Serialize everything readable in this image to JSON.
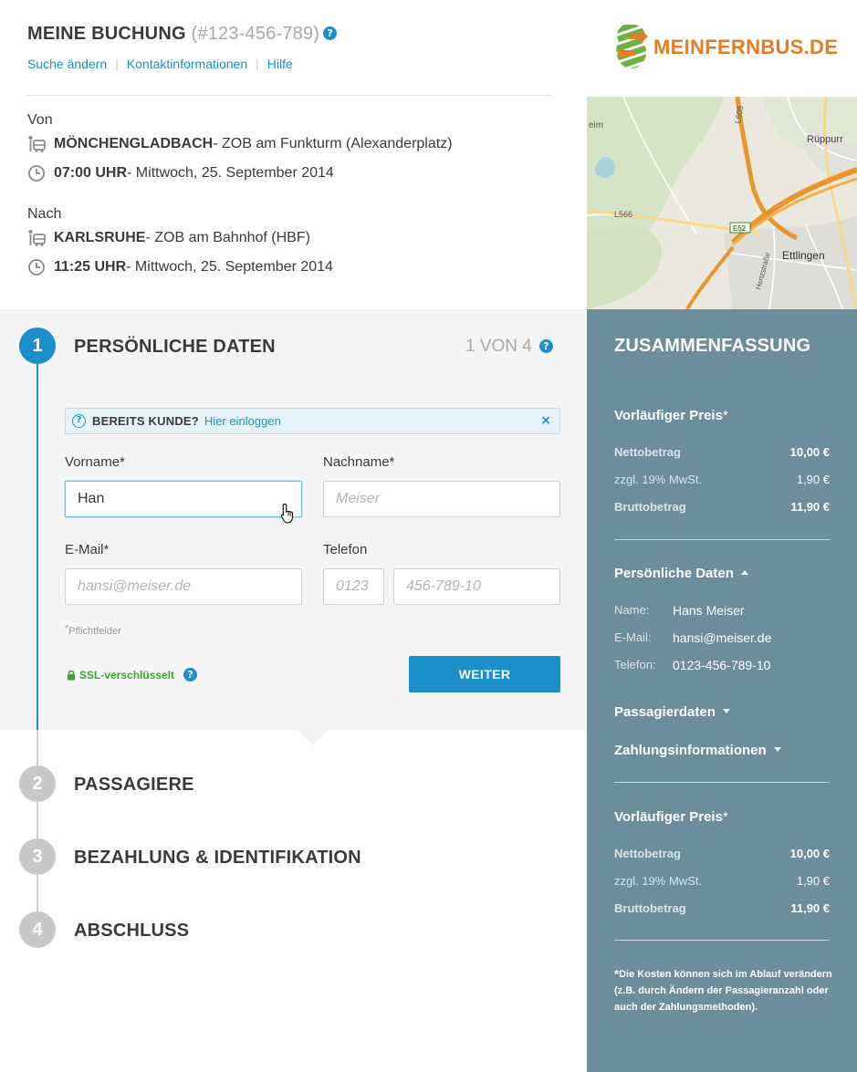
{
  "booking": {
    "title": "MEINE BUCHUNG",
    "number": "(#123-456-789)",
    "help": "?"
  },
  "top_links": {
    "change_search": "Suche ändern",
    "contact": "Kontaktinformationen",
    "help": "Hilfe",
    "separator": "|"
  },
  "route": {
    "from": {
      "label": "Von",
      "city": "MÖNCHENGLADBACH",
      "station": " - ZOB am Funkturm (Alexanderplatz)",
      "time": "07:00 UHR",
      "date": "- Mittwoch, 25. September 2014"
    },
    "to": {
      "label": "Nach",
      "city": "KARLSRUHE",
      "station": " - ZOB am Bahnhof (HBF)",
      "time": "11:25 UHR",
      "date": "- Mittwoch, 25. September 2014"
    }
  },
  "logo": {
    "text": "MEINFERNBUS.DE"
  },
  "map": {
    "labels": {
      "l605": "L605",
      "rueppurr": "Rüppurr",
      "l566": "L566",
      "e52": "E52",
      "ettlingen": "Ettlingen",
      "hertzstrasse": "Hertzstraße",
      "eim": "eim"
    }
  },
  "steps": {
    "step1": {
      "number": "1",
      "title": "PERSÖNLICHE DATEN"
    },
    "step2": {
      "number": "2",
      "title": "PASSAGIERE"
    },
    "step3": {
      "number": "3",
      "title": "BEZAHLUNG & IDENTIFIKATION"
    },
    "step4": {
      "number": "4",
      "title": "ABSCHLUSS"
    },
    "counter": "1 VON 4"
  },
  "login_hint": {
    "icon": "?",
    "question": "BEREITS KUNDE?",
    "link": "Hier einloggen",
    "close": "×"
  },
  "form": {
    "firstname": {
      "label": "Vorname*",
      "value": "Han",
      "placeholder": ""
    },
    "lastname": {
      "label": "Nachname*",
      "value": "",
      "placeholder": "Meiser"
    },
    "email": {
      "label": "E-Mail*",
      "value": "",
      "placeholder": "hansi@meiser.de"
    },
    "phone": {
      "label": "Telefon",
      "prefix_placeholder": "0123",
      "number_placeholder": "456-789-10"
    },
    "required_star": "*",
    "required_note": "Pflichtfelder",
    "ssl": "SSL-verschlüsselt",
    "next_button": "WEITER"
  },
  "summary": {
    "title": "ZUSAMMENFASSUNG",
    "price_block_1": {
      "heading": "Vorläufiger Preis",
      "star": "*",
      "net_label": "Nettobetrag",
      "net_value": "10,00 €",
      "vat_label": "zzgl. 19% MwSt.",
      "vat_value": "1,90 €",
      "gross_label": "Bruttobetrag",
      "gross_value": "11,90 €"
    },
    "personal": {
      "heading": "Persönliche Daten",
      "name_label": "Name:",
      "name_value": "Hans Meiser",
      "email_label": "E-Mail:",
      "email_value": "hansi@meiser.de",
      "phone_label": "Telefon:",
      "phone_value": "0123-456-789-10"
    },
    "passengers_heading": "Passagierdaten",
    "payment_heading": "Zahlungsinformationen",
    "price_block_2": {
      "heading": "Vorläufiger Preis",
      "star": "*",
      "net_label": "Nettobetrag",
      "net_value": "10,00 €",
      "vat_label": "zzgl. 19% MwSt.",
      "vat_value": "1,90 €",
      "gross_label": "Bruttobetrag",
      "gross_value": "11,90 €"
    },
    "footnote_star": "*",
    "footnote": "Die Kosten können sich im Ablauf verändern (z.B. durch Ändern der Passagieranzahl oder auch der Zahlungsmethoden)."
  },
  "colors": {
    "accent": "#1a8fc9",
    "sidebar": "#6b8e9a",
    "logo_orange": "#e57c24",
    "logo_green": "#6cb33e",
    "ssl_green": "#3aa62e"
  },
  "icons": {
    "help": "help-icon",
    "bus_stop": "bus-stop-icon",
    "clock": "clock-icon",
    "lock": "lock-icon",
    "close": "close-icon",
    "caret_up": "caret-up-icon",
    "caret_down": "caret-down-icon",
    "cursor": "hand-cursor-icon"
  }
}
